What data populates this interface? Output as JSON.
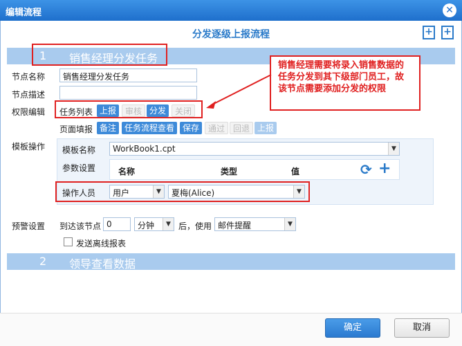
{
  "window": {
    "title": "编辑流程"
  },
  "heading": "分发逐级上报流程",
  "section1": {
    "num": "1",
    "name": "销售经理分发任务"
  },
  "section2": {
    "num": "2",
    "name": "领导查看数据"
  },
  "fields": {
    "node_name_label": "节点名称",
    "node_name_value": "销售经理分发任务",
    "node_desc_label": "节点描述",
    "node_desc_value": "",
    "perm_label": "权限编辑",
    "task_list_label": "任务列表",
    "task_buttons": [
      "上报",
      "审核",
      "分发",
      "关闭"
    ],
    "page_fill_label": "页面填报",
    "page_buttons": [
      "备注",
      "任务流程查看",
      "保存",
      "通过",
      "回退",
      "上报"
    ],
    "template_label": "模板操作"
  },
  "template": {
    "name_label": "模板名称",
    "name_value": "WorkBook1.cpt",
    "params_label": "参数设置",
    "col_name": "名称",
    "col_type": "类型",
    "col_value": "值",
    "operator_label": "操作人员",
    "operator_type": "用户",
    "operator_value": "夏梅(Alice)"
  },
  "warning": {
    "label": "预警设置",
    "reach_label": "到达该节点",
    "value": "0",
    "unit": "分钟",
    "after_label": "后，使用",
    "method": "邮件提醒",
    "offline_label": "发送离线报表"
  },
  "callout": "销售经理需要将录入销售数据的任务分发到其下级部门员工，故该节点需要添加分发的权限",
  "footer": {
    "ok": "确定",
    "cancel": "取消"
  },
  "colors": {
    "accent": "#2a7ac9",
    "section": "#a9cbee",
    "highlight": "#e02020"
  }
}
